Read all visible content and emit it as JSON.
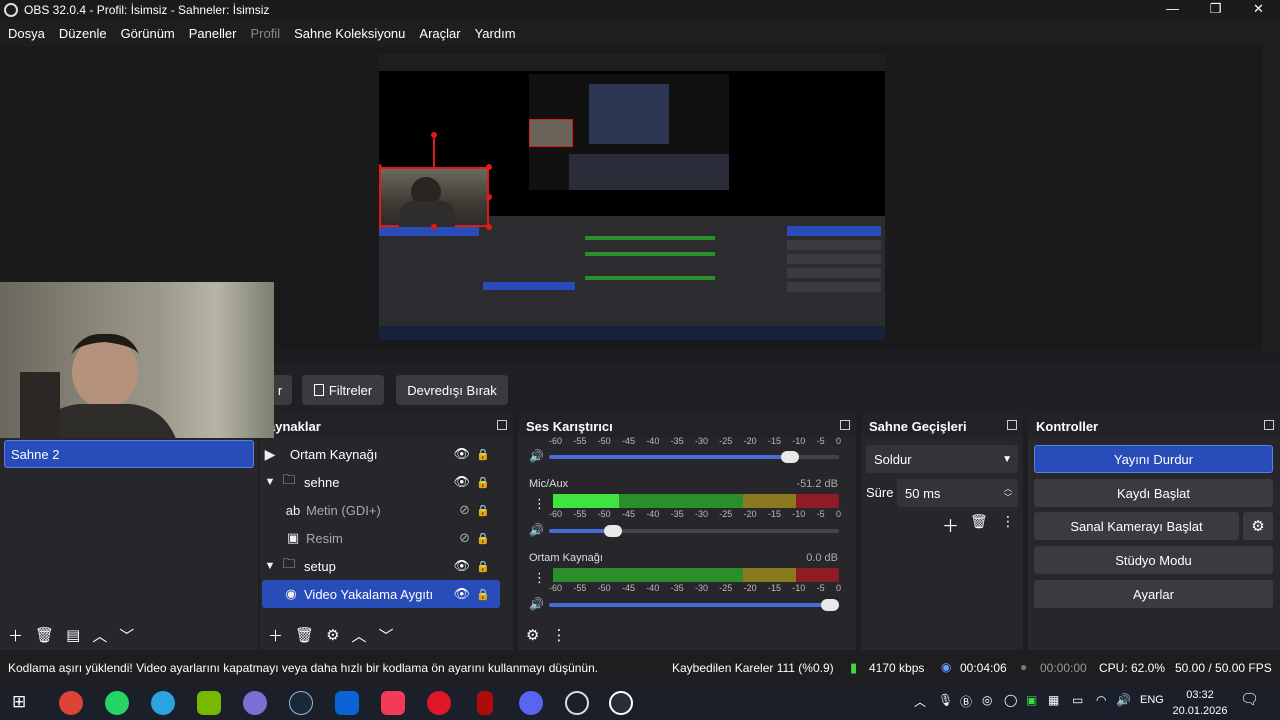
{
  "window": {
    "title": "OBS 32.0.4 - Profil: İsimsiz - Sahneler: İsimsiz",
    "controls": [
      "—",
      "❐",
      "✕"
    ]
  },
  "menu": {
    "items": [
      "Dosya",
      "Düzenle",
      "Görünüm",
      "Paneller",
      "Profil",
      "Sahne Koleksiyonu",
      "Araçlar",
      "Yardım"
    ]
  },
  "transition_bar": {
    "partial_label": "r",
    "filters_label": "Filtreler",
    "disable_label": "Devredışı Bırak"
  },
  "scenes": {
    "items": [
      "Sahne 2"
    ]
  },
  "sources": {
    "title": "aynaklar",
    "items": [
      {
        "label": "Ortam Kaynağı",
        "icon": "play-icon"
      },
      {
        "label": "sehne",
        "icon": "folder-icon"
      },
      {
        "label": "Metin (GDI+)",
        "icon": "text-icon"
      },
      {
        "label": "Resim",
        "icon": "image-icon"
      },
      {
        "label": "setup",
        "icon": "folder-icon"
      },
      {
        "label": "Video Yakalama Aygıtı",
        "icon": "camera-icon"
      }
    ]
  },
  "mixer": {
    "title": "Ses Karıştırıcı",
    "ticks": [
      "-60",
      "-55",
      "-50",
      "-45",
      "-40",
      "-35",
      "-30",
      "-25",
      "-20",
      "-15",
      "-10",
      "-5",
      "0"
    ],
    "channels": [
      {
        "name": "Mic/Aux",
        "db": "-51.2 dB",
        "meter_level": 0.23,
        "volume": 0.22
      },
      {
        "name": "Ortam Kaynağı",
        "db": "0.0 dB",
        "meter_level": 0.0,
        "volume": 0.97
      }
    ],
    "top_volume": 0.83
  },
  "transitions": {
    "title": "Sahne Geçişleri",
    "selected": "Soldur",
    "duration_label": "Süre",
    "duration_value": "50 ms"
  },
  "controls": {
    "title": "Kontroller",
    "stop_stream": "Yayını Durdur",
    "start_record": "Kaydı Başlat",
    "start_vcam": "Sanal Kamerayı Başlat",
    "studio_mode": "Stüdyo Modu",
    "settings": "Ayarlar"
  },
  "status": {
    "warning": "Kodlama aşırı yüklendi! Video ayarlarını kapatmayı veya daha hızlı bir kodlama ön ayarını kullanmayı düşünün.",
    "dropped": "Kaybedilen Kareler 111 (%0.9)",
    "bitrate": "4170 kbps",
    "stream_time": "00:04:06",
    "record_time": "00:00:00",
    "cpu": "CPU: 62.0%",
    "fps": "50.00 / 50.00 FPS"
  },
  "taskbar": {
    "lang": "ENG",
    "time": "03:32",
    "date": "20.01.2026"
  },
  "colors": {
    "accent": "#284cb8",
    "panel": "#26262b",
    "meter_green": "#2a8f2a",
    "meter_yellow": "#8a7a1f",
    "meter_red": "#8d1c24"
  }
}
